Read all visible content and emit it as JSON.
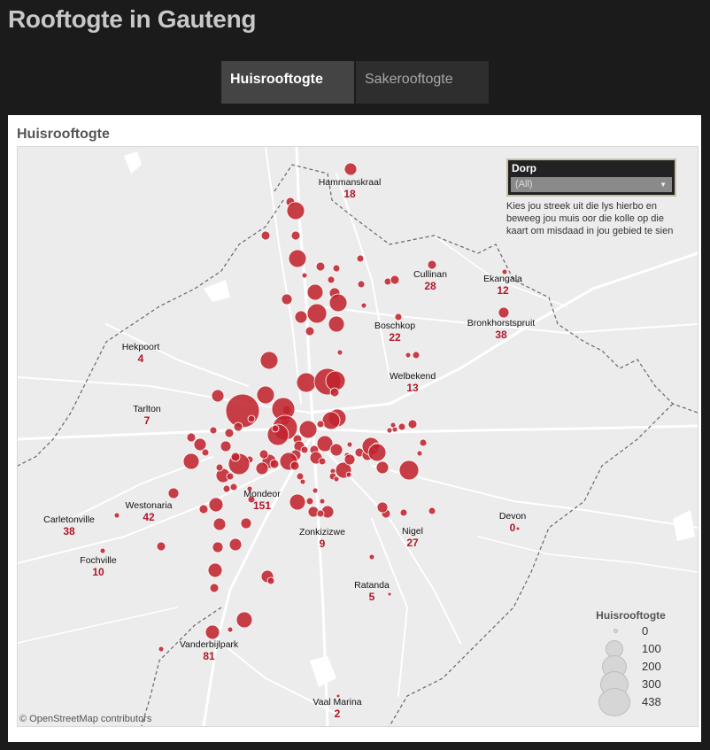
{
  "app": {
    "title": "Rooftogte in Gauteng"
  },
  "tabs": [
    {
      "label": "Huisrooftogte",
      "active": true
    },
    {
      "label": "Sakerooftogte",
      "active": false
    }
  ],
  "panel": {
    "title": "Huisrooftogte"
  },
  "filter": {
    "label": "Dorp",
    "selected": "(All)",
    "help": "Kies jou streek uit die lys hierbo en beweeg jou muis oor die kolle op die kaart om misdaad in jou gebied te sien"
  },
  "legend": {
    "title": "Huisrooftogte",
    "values": [
      "0",
      "100",
      "200",
      "300",
      "438"
    ]
  },
  "attribution": "© OpenStreetMap contributors",
  "colors": {
    "bubble": "#c1242f",
    "count": "#b0172a",
    "map_bg": "#ececec",
    "roads": "#ffffff"
  },
  "towns": [
    {
      "name": "Hammanskraal",
      "count": "18"
    },
    {
      "name": "Cullinan",
      "count": "28"
    },
    {
      "name": "Ekangala",
      "count": "12"
    },
    {
      "name": "Boschkop",
      "count": "22"
    },
    {
      "name": "Bronkhorstspruit",
      "count": "38"
    },
    {
      "name": "Hekpoort",
      "count": "4"
    },
    {
      "name": "Welbekend",
      "count": "13"
    },
    {
      "name": "Tarlton",
      "count": "7"
    },
    {
      "name": "Westonaria",
      "count": "42"
    },
    {
      "name": "Mondeor",
      "count": "151"
    },
    {
      "name": "Carletonville",
      "count": "38"
    },
    {
      "name": "Zonkizizwe",
      "count": "9"
    },
    {
      "name": "Nigel",
      "count": "27"
    },
    {
      "name": "Devon",
      "count": "0"
    },
    {
      "name": "Fochville",
      "count": "10"
    },
    {
      "name": "Ratanda",
      "count": "5"
    },
    {
      "name": "Vanderbijlpark",
      "count": "81"
    },
    {
      "name": "Vaal Marina",
      "count": "2"
    }
  ]
}
